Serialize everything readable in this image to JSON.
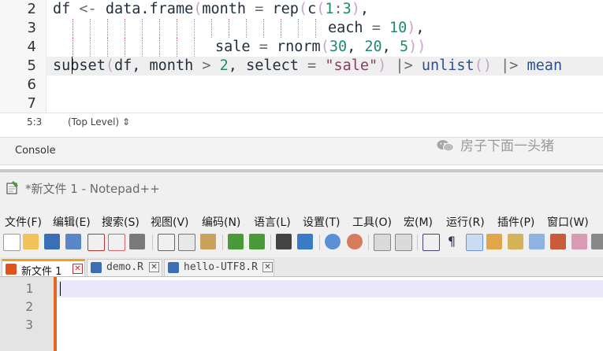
{
  "rstudio": {
    "gutter_numbers": [
      "2",
      "3",
      "4",
      "5",
      "6",
      "7"
    ],
    "code": {
      "line2": [
        "df ",
        "<-",
        " data.frame",
        "(",
        "month",
        " = ",
        "rep",
        "(",
        "c",
        "(",
        "1",
        ":",
        "3",
        ")",
        ","
      ],
      "line3": [
        "each",
        " = ",
        "10",
        ")",
        ","
      ],
      "line4": [
        "sale",
        " = ",
        "rnorm",
        "(",
        "30",
        ", ",
        "20",
        ", ",
        "5",
        "))"
      ],
      "line5": [
        "subset",
        "(",
        "df",
        ", ",
        "month",
        " > ",
        "2",
        ", ",
        "select",
        " = ",
        "\"sale\"",
        ")",
        " |> ",
        "unlist",
        "()",
        " |> ",
        "mean"
      ]
    },
    "status": {
      "position": "5:3",
      "scope": "(Top Level)",
      "scope_arrow": "⇕"
    },
    "console_tab": "Console"
  },
  "notepad": {
    "title": "*新文件 1 - Notepad++",
    "menu": [
      "文件(F)",
      "编辑(E)",
      "搜索(S)",
      "视图(V)",
      "编码(N)",
      "语言(L)",
      "设置(T)",
      "工具(O)",
      "宏(M)",
      "运行(R)",
      "插件(P)",
      "窗口(W)"
    ],
    "tabs": [
      {
        "label": "新文件 1",
        "close": "✕"
      },
      {
        "label": "demo.R",
        "close": "✕"
      },
      {
        "label": "hello-UTF8.R",
        "close": "✕"
      }
    ],
    "line_numbers": [
      "1",
      "2",
      "3"
    ],
    "colors": {
      "accent": "#e06b1f",
      "tab_active": "#f0a11a",
      "current_line": "#e8e8fa"
    }
  },
  "watermark": {
    "text": "房子下面一头猪",
    "icon": "wechat-icon"
  }
}
